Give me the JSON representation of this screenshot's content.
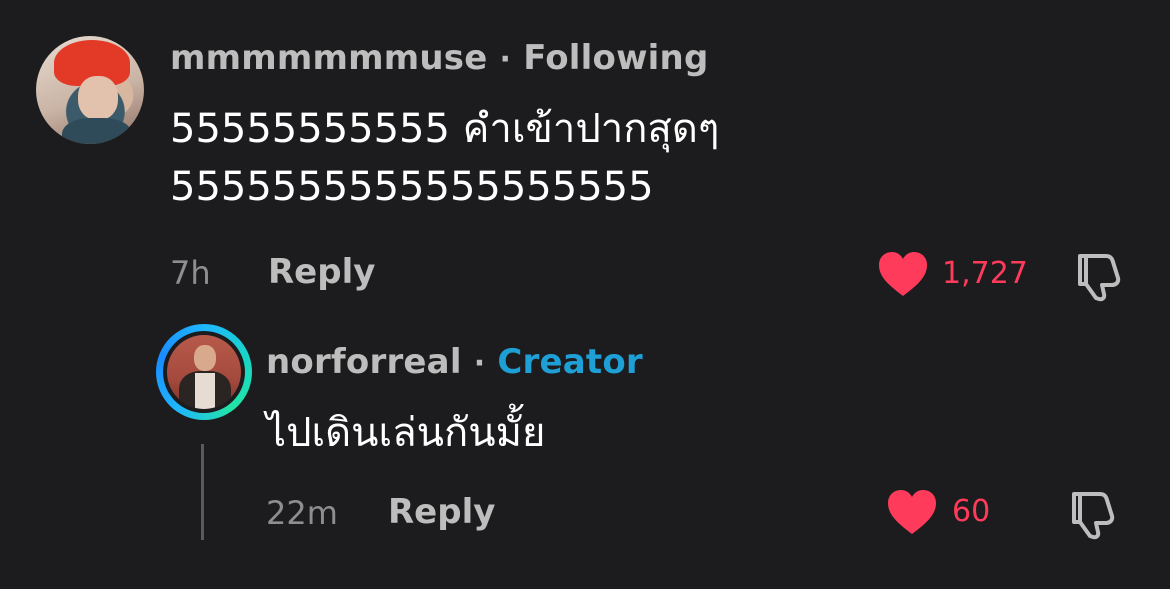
{
  "comment": {
    "username": "mmmmmmmuse",
    "separator": "·",
    "badge": "Following",
    "text_line1": "55555555555 คำเข้าปากสุดๆ",
    "text_line2": "5555555555555555555",
    "time": "7h",
    "reply_label": "Reply",
    "like_count": "1,727"
  },
  "reply": {
    "username": "norforreal",
    "separator": "·",
    "badge": "Creator",
    "text": "ไปเดินเล่นกันมั้ย",
    "time": "22m",
    "reply_label": "Reply",
    "like_count": "60"
  },
  "colors": {
    "background": "#1c1c1e",
    "like_red": "#ff3b5c",
    "creator_blue": "#1ea0d6"
  },
  "icons": [
    "heart-icon",
    "dislike-icon"
  ]
}
